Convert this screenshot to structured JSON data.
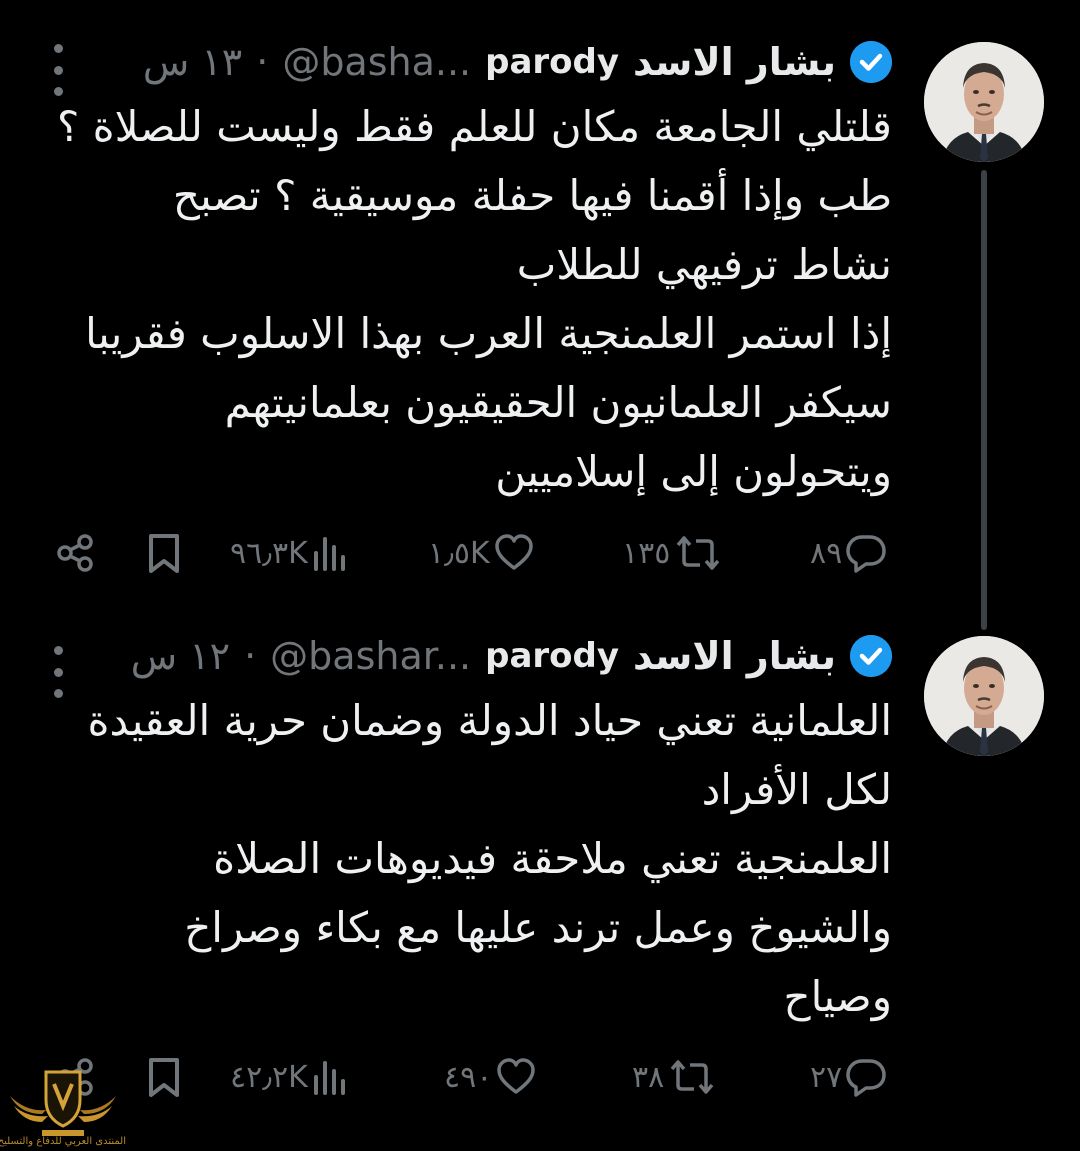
{
  "tweets": [
    {
      "display_name": "بشار الاسد",
      "parody_label": "parody",
      "handle": "@basha...",
      "separator": "·",
      "time": "١٣ س",
      "lines": [
        "قلتلي الجامعة مكان للعلم فقط وليست للصلاة ؟",
        "طب وإذا أقمنا فيها حفلة موسيقية ؟ تصبح",
        "نشاط ترفيهي للطلاب",
        "إذا استمر العلمنجية العرب بهذا الاسلوب فقريبا",
        "سيكفر العلمانيون الحقيقيون بعلمانيتهم",
        "ويتحولون إلى إسلاميين"
      ],
      "replies": "٨٩",
      "reposts": "١٣٥",
      "likes": "١٫٥K",
      "views": "٩٦٫٣K"
    },
    {
      "display_name": "بشار الاسد",
      "parody_label": "parody",
      "handle": "@bashar...",
      "separator": "·",
      "time": "١٢ س",
      "lines": [
        "العلمانية تعني حياد الدولة وضمان حرية العقيدة",
        "لكل الأفراد",
        "العلمنجية تعني ملاحقة فيديوهات الصلاة",
        "والشيوخ وعمل ترند عليها مع بكاء وصراخ",
        "وصياح"
      ],
      "replies": "٢٧",
      "reposts": "٣٨",
      "likes": "٤٩٠",
      "views": "٤٢٫٢K"
    }
  ],
  "icons": {
    "more": "more-vertical-icon",
    "verified": "verified-badge-icon",
    "reply": "reply-icon",
    "repost": "repost-icon",
    "like": "like-icon",
    "views": "views-icon",
    "bookmark": "bookmark-icon",
    "share": "share-icon"
  },
  "colors": {
    "background": "#000000",
    "text": "#e7e9ea",
    "muted": "#71767b",
    "verified": "#1d9bf0"
  },
  "watermark": {
    "text": "المنتدى العربي للدفاع والتسليح"
  }
}
